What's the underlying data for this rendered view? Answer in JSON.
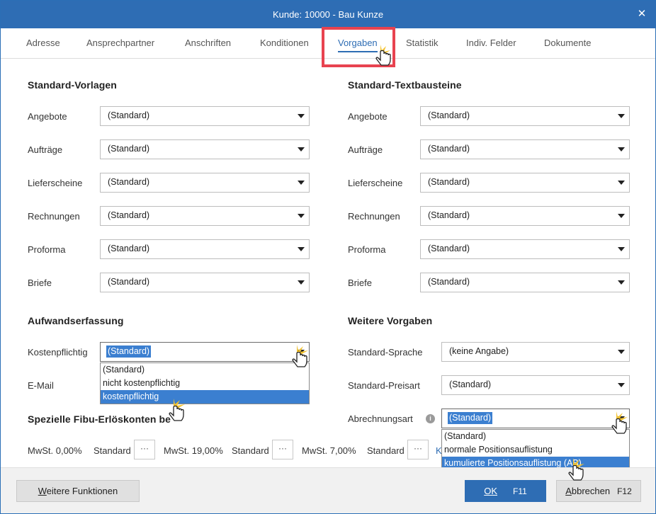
{
  "window": {
    "title": "Kunde: 10000 - Bau Kunze",
    "close_glyph": "✕"
  },
  "tabs": [
    {
      "label": "Adresse"
    },
    {
      "label": "Ansprechpartner"
    },
    {
      "label": "Anschriften"
    },
    {
      "label": "Konditionen"
    },
    {
      "label": "Vorgaben"
    },
    {
      "label": "Statistik"
    },
    {
      "label": "Indiv. Felder"
    },
    {
      "label": "Dokumente"
    }
  ],
  "active_tab": "Vorgaben",
  "standard_vorlagen": {
    "title": "Standard-Vorlagen",
    "rows": [
      {
        "label": "Angebote",
        "value": "(Standard)"
      },
      {
        "label": "Aufträge",
        "value": "(Standard)"
      },
      {
        "label": "Lieferscheine",
        "value": "(Standard)"
      },
      {
        "label": "Rechnungen",
        "value": "(Standard)"
      },
      {
        "label": "Proforma",
        "value": "(Standard)"
      },
      {
        "label": "Briefe",
        "value": "(Standard)"
      }
    ]
  },
  "standard_textbausteine": {
    "title": "Standard-Textbausteine",
    "rows": [
      {
        "label": "Angebote",
        "value": "(Standard)"
      },
      {
        "label": "Aufträge",
        "value": "(Standard)"
      },
      {
        "label": "Lieferscheine",
        "value": "(Standard)"
      },
      {
        "label": "Rechnungen",
        "value": "(Standard)"
      },
      {
        "label": "Proforma",
        "value": "(Standard)"
      },
      {
        "label": "Briefe",
        "value": "(Standard)"
      }
    ]
  },
  "aufwandserfassung": {
    "title": "Aufwandserfassung",
    "kosten_label": "Kostenpflichtig",
    "kosten_value": "(Standard)",
    "kosten_options": [
      "(Standard)",
      "nicht kostenpflichtig",
      "kostenpflichtig"
    ],
    "kosten_highlighted_index": 2,
    "email_label": "E-Mail"
  },
  "weitere_vorgaben": {
    "title": "Weitere Vorgaben",
    "sprache_label": "Standard-Sprache",
    "sprache_value": "(keine Angabe)",
    "preisart_label": "Standard-Preisart",
    "preisart_value": "(Standard)",
    "abrechnung_label": "Abrechnungsart",
    "abrechnung_value": "(Standard)",
    "abrechnung_options": [
      "(Standard)",
      "normale Positionsauflistung",
      "kumulierte Positionsauflistung (AB)"
    ],
    "abrechnung_highlighted_index": 2
  },
  "fibu": {
    "title": "Spezielle Fibu-Erlöskonten be",
    "items": [
      {
        "label": "MwSt. 0,00%",
        "value": "Standard"
      },
      {
        "label": "MwSt. 19,00%",
        "value": "Standard"
      },
      {
        "label": "MwSt. 7,00%",
        "value": "Standard"
      }
    ],
    "dots": "···",
    "trailing_letter": "K"
  },
  "footer": {
    "more_functions_label_u": "W",
    "more_functions_label_rest": "eitere Funktionen",
    "ok_label": "OK",
    "ok_key": "F11",
    "cancel_label_u": "A",
    "cancel_label_rest": "bbrechen",
    "cancel_key": "F12"
  },
  "colors": {
    "accent": "#2e6db4",
    "highlight_box": "#e84350",
    "selection": "#3b7fd0"
  }
}
